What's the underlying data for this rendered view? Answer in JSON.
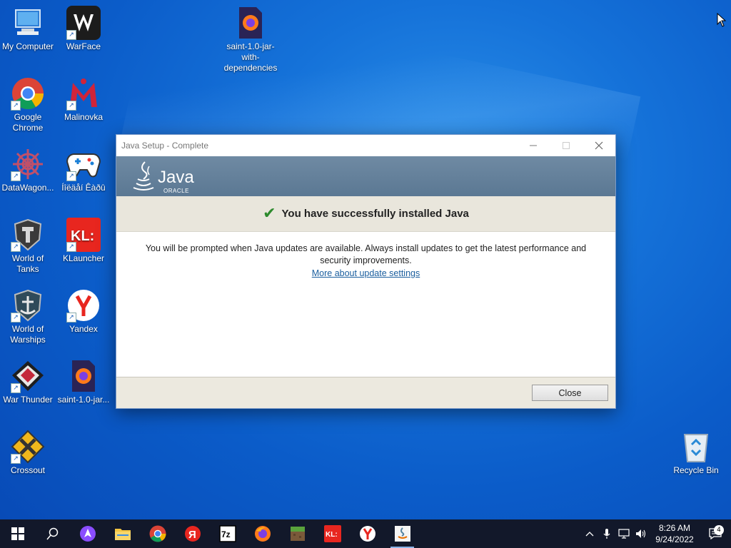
{
  "desktop": {
    "icons": [
      {
        "label": "My Computer"
      },
      {
        "label": "WarFace"
      },
      {
        "label": "saint-1.0-jar-with-dependencies"
      },
      {
        "label": "Google Chrome"
      },
      {
        "label": "Malinovka"
      },
      {
        "label": "DataWagon..."
      },
      {
        "label": "Íîëäåí Êàðû"
      },
      {
        "label": "World of Tanks"
      },
      {
        "label": "KLauncher"
      },
      {
        "label": "World of Warships"
      },
      {
        "label": "Yandex"
      },
      {
        "label": "War Thunder"
      },
      {
        "label": "saint-1.0-jar..."
      },
      {
        "label": "Crossout"
      },
      {
        "label": "Recycle Bin"
      }
    ]
  },
  "dialog": {
    "title": "Java Setup - Complete",
    "logo_text": "Java",
    "logo_sub": "ORACLE",
    "headline": "You have successfully installed Java",
    "message": "You will be prompted when Java updates are available. Always install updates to get the latest performance and security improvements.",
    "link": "More about update settings",
    "close_label": "Close"
  },
  "taskbar": {
    "apps": [
      "start",
      "search",
      "alice",
      "file-explorer",
      "chrome",
      "yandex-music",
      "7zip",
      "firefox",
      "minecraft",
      "klauncher",
      "yandex-browser",
      "java-setup"
    ],
    "clock_time": "8:26 AM",
    "clock_date": "9/24/2022",
    "notification_count": "4"
  }
}
